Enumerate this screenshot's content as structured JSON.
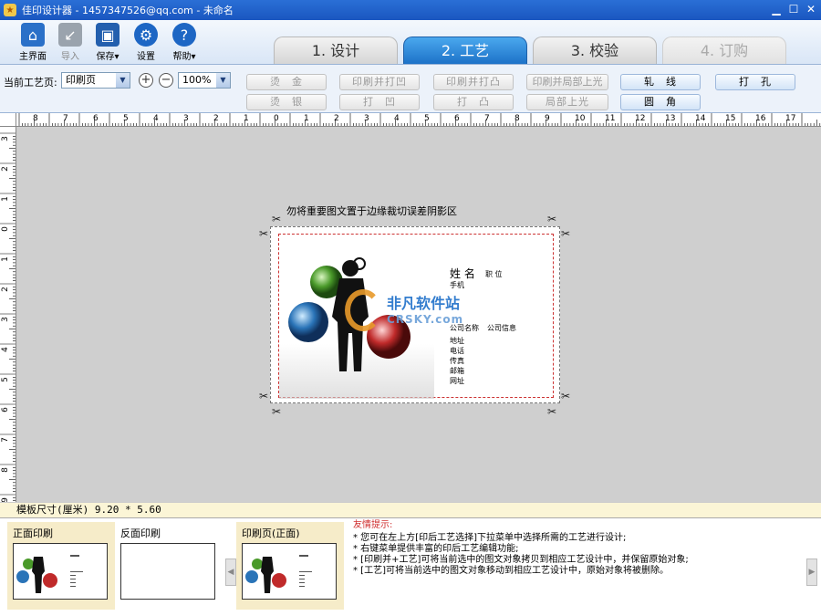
{
  "window": {
    "title": "佳印设计器 - 1457347526@qq.com - 未命名"
  },
  "toolbar": {
    "home": "主界面",
    "import": "导入",
    "save": "保存",
    "settings": "设置",
    "help": "帮助"
  },
  "steps": [
    "1. 设计",
    "2. 工艺",
    "3. 校验",
    "4. 订购"
  ],
  "process": {
    "label": "当前工艺页:",
    "page_value": "印刷页",
    "zoom_value": "100%",
    "buttons": {
      "hot_gold": "烫　金",
      "hot_silver": "烫　银",
      "print_emboss": "印刷并打凹",
      "emboss": "打　凹",
      "print_raise": "印刷并打凸",
      "raise": "打　凸",
      "print_spot_gloss": "印刷并局部上光",
      "spot_gloss": "局部上光",
      "crease": "轧　线",
      "round_corner": "圆　角",
      "punch": "打　孔"
    }
  },
  "ruler": {
    "top_labels": [
      "8",
      "7",
      "6",
      "5",
      "4",
      "3",
      "2",
      "1",
      "0",
      "1",
      "2",
      "3",
      "4",
      "5",
      "6",
      "7",
      "8",
      "9",
      "10",
      "11",
      "12",
      "13",
      "14",
      "15",
      "16",
      "17"
    ],
    "left_labels": [
      "3",
      "2",
      "1",
      "0",
      "1",
      "2",
      "3",
      "4",
      "5",
      "6",
      "7",
      "8",
      "9"
    ]
  },
  "canvas": {
    "warning": "勿将重要图文置于边缘裁切误差阴影区",
    "card": {
      "name": "姓 名",
      "position": "职 位",
      "mobile": "手机",
      "company": "公司名称",
      "company_info": "公司信息",
      "address": "地址",
      "phone": "电话",
      "fax": "传真",
      "email": "邮箱",
      "website": "网址"
    },
    "watermark": {
      "cn": "非凡软件站",
      "en": "CRSKY.com"
    }
  },
  "status": {
    "template_size": "模板尺寸(厘米) 9.20 * 5.60"
  },
  "bottom": {
    "front_print": "正面印刷",
    "back_print": "反面印刷",
    "print_page": "印刷页(正面)",
    "tips_head": "友情提示:",
    "tips": [
      "* 您可在左上方[印后工艺选择]下拉菜单中选择所需的工艺进行设计;",
      "* 右键菜单提供丰富的印后工艺编辑功能;",
      "* [印刷并+工艺]可将当前选中的图文对象拷贝到相应工艺设计中，并保留原始对象;",
      "* [工艺]可将当前选中的图文对象移动到相应工艺设计中，原始对象将被删除。"
    ]
  }
}
